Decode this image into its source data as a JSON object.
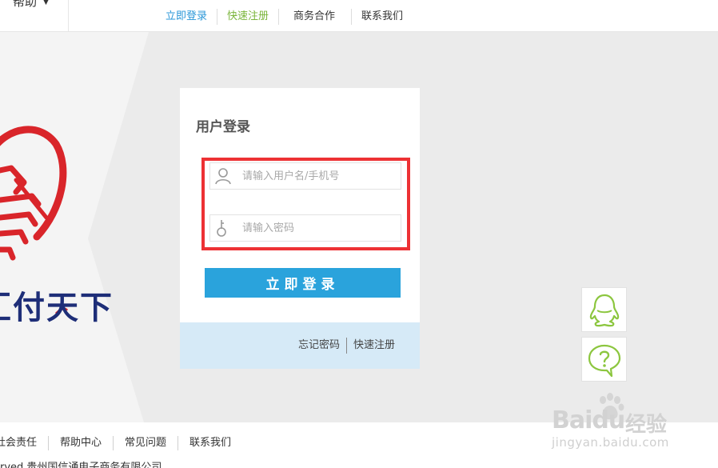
{
  "topbar": {
    "help_label": "帮助",
    "help_caret": "▼",
    "nav": [
      {
        "label": "立即登录"
      },
      {
        "label": "快速注册"
      },
      {
        "label": "商务合作"
      },
      {
        "label": "联系我们"
      }
    ]
  },
  "banner": {
    "logo_text": "汇付天下"
  },
  "login": {
    "title": "用户登录",
    "username_placeholder": "请输入用户名/手机号",
    "password_placeholder": "请输入密码",
    "submit_label": "立即登录",
    "forgot_label": "忘记密码",
    "register_label": "快速注册"
  },
  "side": {
    "qq_icon": "qq-penguin-icon",
    "faq_icon": "question-bubble-icon"
  },
  "watermark": {
    "brand": "Bai",
    "brand2": "du",
    "cn": "经验",
    "url": "jingyan.baidu.com"
  },
  "footer": {
    "links": [
      {
        "label": "社会责任"
      },
      {
        "label": "帮助中心"
      },
      {
        "label": "常见问题"
      },
      {
        "label": "联系我们"
      }
    ],
    "copyright": "erved 贵州国信通电子商务有限公司"
  },
  "colors": {
    "accent_blue": "#2aa3dc",
    "link_blue": "#2a97d8",
    "link_green": "#7ab53a",
    "highlight_red": "#ed3134",
    "logo_red": "#d9252a",
    "logo_navy": "#1e2e78",
    "icon_green": "#8cc63f"
  }
}
